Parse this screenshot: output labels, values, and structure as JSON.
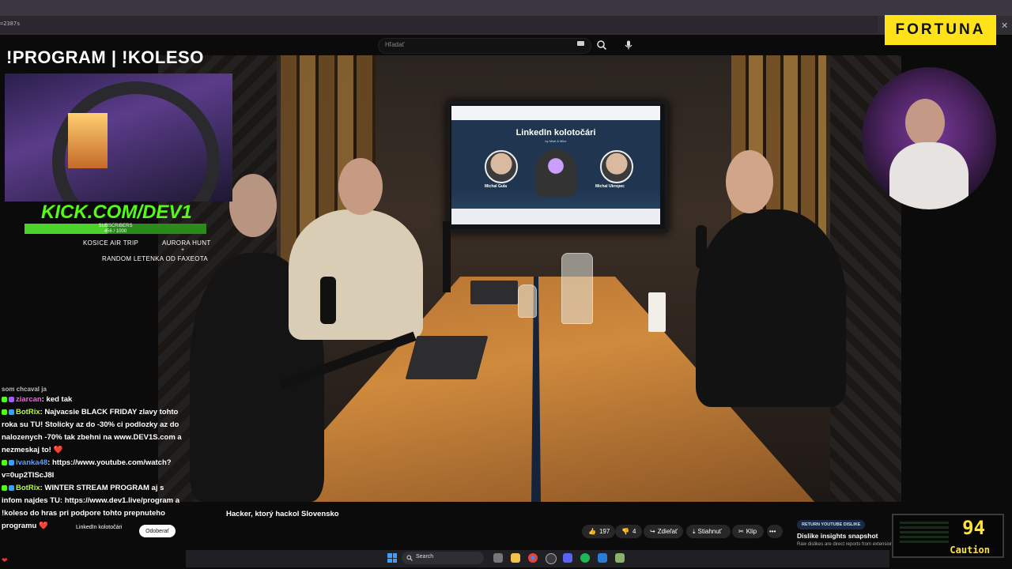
{
  "browser": {
    "url_fragment": "=2387s",
    "search_placeholder": "Hľadať"
  },
  "sponsor": {
    "label": "FORTUNA"
  },
  "overlay": {
    "title": "!PROGRAM | !KOLESO",
    "kick_logo": "KICK.COM/DEV1",
    "subscribers_label": "SUBSCRIBERS",
    "subscribers_count": "456 / 1000",
    "subscribers_progress": 0.456,
    "trip1": "KOSICE AIR TRIP",
    "trip2": "AURORA HUNT",
    "plus": "+",
    "trip3": "RANDOM LETENKA OD FAXEOTA"
  },
  "tv": {
    "title": "LinkedIn kolotočári",
    "subtitle": "by Misti & Mike",
    "name_left": "Michal Gula",
    "name_right": "Michal Ukropec"
  },
  "chat": {
    "partial_line": "som chcaval ja",
    "messages": [
      {
        "user": "ziarcan",
        "text": ": ked tak"
      },
      {
        "user": "BotRix",
        "text": ": Najvacsie BLACK FRIDAY zlavy tohto roka su TU! Stolicky az do -30% ci podlozky az do nalozenych -70% tak zbehni na www.DEV1S.com a nezmeskaj to! ❤️"
      },
      {
        "user": "ivanka48",
        "text": ": https://www.youtube.com/watch?v=0up2TIScJ8I"
      },
      {
        "user": "BotRix",
        "text": ": WINTER STREAM PROGRAM aj s infom najdes TU: https://www.dev1.live/program a !koleso do hras pri podpore tohto prepnuteho programu ❤️"
      }
    ]
  },
  "video": {
    "subject": "Hacker, ktorý hackol Slovensko",
    "channel": "LinkedIn kolotočári",
    "subscribe": "Odoberať",
    "likes": "197",
    "dislikes": "4",
    "share": "Zdieľať",
    "download": "Stiahnuť",
    "clip": "Klip",
    "more": "•••"
  },
  "dislike_card": {
    "button": "RETURN YOUTUBE DISLIKE",
    "title": "Dislike insights snapshot",
    "desc": "Raw dislikes are direct reports from extension"
  },
  "caution": {
    "value": "94",
    "label": "Caution"
  },
  "taskbar": {
    "search": "Search"
  },
  "colors": {
    "kick_green": "#53fc18",
    "fortuna_yellow": "#ffe318",
    "caution_yellow": "#ffe23a"
  }
}
